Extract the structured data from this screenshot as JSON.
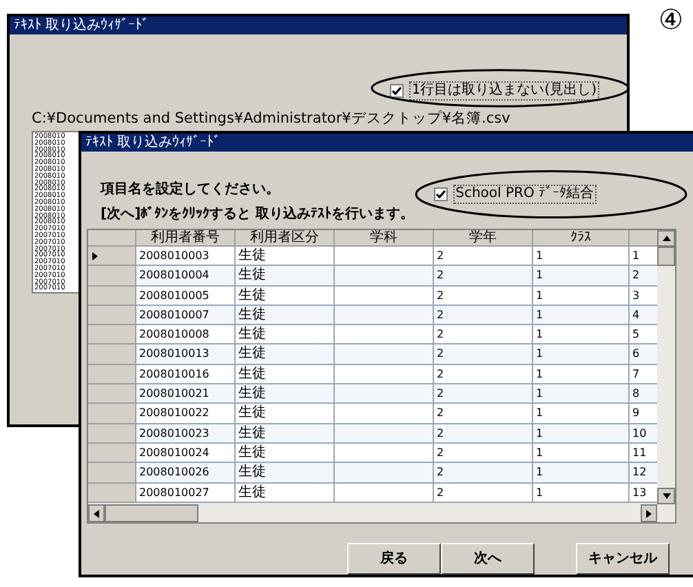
{
  "step_mark": "④",
  "back_window": {
    "title": "ﾃｷｽﾄ 取り込みｳｨｻﾞｰﾄﾞ",
    "checkbox": {
      "label": "1行目は取り込まない(見出し)",
      "checked": true
    },
    "path": "C:¥Documents and Settings¥Administrator¥デスクトップ¥名簿.csv",
    "list_rows": [
      "2008010",
      "2008010",
      "2008010",
      "2008010",
      "2008010",
      "2008010",
      "2008010",
      "2008010",
      "2008010",
      "2008010",
      "2008010",
      "2008010",
      "2008010",
      "2008010",
      "2007010",
      "2007010",
      "2007010",
      "2007010",
      "2007010",
      "2007010",
      "2007010",
      "2007010",
      "2007010",
      "2007010"
    ]
  },
  "front_window": {
    "title": "ﾃｷｽﾄ 取り込みｳｨｻﾞｰﾄﾞ",
    "instruction": "項目名を設定してください。",
    "hint": "[次へ]ﾎﾞﾀﾝをｸﾘｯｸすると 取り込みﾃｽﾄを行います。",
    "checkbox": {
      "label": "School PRO ﾃﾞｰﾀ結合",
      "checked": true
    },
    "table": {
      "columns": [
        "利用者番号",
        "利用者区分",
        "学科",
        "学年",
        "ｸﾗｽ"
      ],
      "rows": [
        {
          "selected": true,
          "cells": [
            "2008010003",
            "生徒",
            "",
            "2",
            "1",
            "1"
          ]
        },
        {
          "selected": false,
          "cells": [
            "2008010004",
            "生徒",
            "",
            "2",
            "1",
            "2"
          ]
        },
        {
          "selected": false,
          "cells": [
            "2008010005",
            "生徒",
            "",
            "2",
            "1",
            "3"
          ]
        },
        {
          "selected": false,
          "cells": [
            "2008010007",
            "生徒",
            "",
            "2",
            "1",
            "4"
          ]
        },
        {
          "selected": false,
          "cells": [
            "2008010008",
            "生徒",
            "",
            "2",
            "1",
            "5"
          ]
        },
        {
          "selected": false,
          "cells": [
            "2008010013",
            "生徒",
            "",
            "2",
            "1",
            "6"
          ]
        },
        {
          "selected": false,
          "cells": [
            "2008010016",
            "生徒",
            "",
            "2",
            "1",
            "7"
          ]
        },
        {
          "selected": false,
          "cells": [
            "2008010021",
            "生徒",
            "",
            "2",
            "1",
            "8"
          ]
        },
        {
          "selected": false,
          "cells": [
            "2008010022",
            "生徒",
            "",
            "2",
            "1",
            "9"
          ]
        },
        {
          "selected": false,
          "cells": [
            "2008010023",
            "生徒",
            "",
            "2",
            "1",
            "10"
          ]
        },
        {
          "selected": false,
          "cells": [
            "2008010024",
            "生徒",
            "",
            "2",
            "1",
            "11"
          ]
        },
        {
          "selected": false,
          "cells": [
            "2008010026",
            "生徒",
            "",
            "2",
            "1",
            "12"
          ]
        },
        {
          "selected": false,
          "cells": [
            "2008010027",
            "生徒",
            "",
            "2",
            "1",
            "13"
          ]
        }
      ]
    },
    "buttons": [
      "戻る",
      "次へ",
      "キャンセル"
    ]
  }
}
